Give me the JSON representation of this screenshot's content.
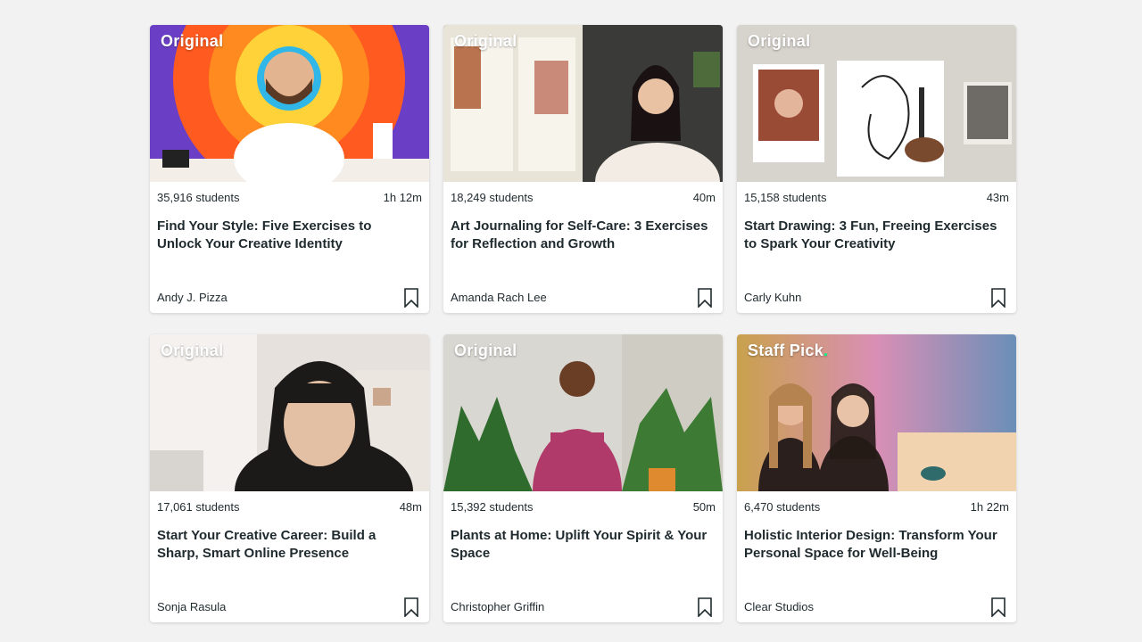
{
  "badge_dot": ".",
  "courses": [
    {
      "badge": "Original",
      "students": "35,916 students",
      "duration": "1h 12m",
      "title": "Find Your Style: Five Exercises to Unlock Your Creative Identity",
      "author": "Andy J. Pizza",
      "thumb_colors": [
        "#6a3fc6",
        "#ff5a1f",
        "#ffd23a",
        "#30b7e8"
      ]
    },
    {
      "badge": "Original",
      "students": "18,249 students",
      "duration": "40m",
      "title": "Art Journaling for Self-Care: 3 Exercises for Reflection and Growth",
      "author": "Amanda Rach Lee",
      "thumb_colors": [
        "#e9e4d8",
        "#2f3b33",
        "#c98a7a",
        "#4e6b3c"
      ]
    },
    {
      "badge": "Original",
      "students": "15,158 students",
      "duration": "43m",
      "title": "Start Drawing: 3 Fun, Freeing Exercises to Spark Your Creativity",
      "author": "Carly Kuhn",
      "thumb_colors": [
        "#efece7",
        "#d7d3cd",
        "#9a4b35",
        "#2a2a2a"
      ]
    },
    {
      "badge": "Original",
      "students": "17,061 students",
      "duration": "48m",
      "title": "Start Your Creative Career: Build a Sharp, Smart Online Presence",
      "author": "Sonja Rasula",
      "thumb_colors": [
        "#e6e1dc",
        "#f4f1ee",
        "#1c1a19",
        "#c9a68c"
      ]
    },
    {
      "badge": "Original",
      "students": "15,392 students",
      "duration": "50m",
      "title": "Plants at Home: Uplift Your Spirit & Your Space",
      "author": "Christopher Griffin",
      "thumb_colors": [
        "#d9d7d1",
        "#2f6b2c",
        "#b03a6a",
        "#e08a30"
      ]
    },
    {
      "badge": "Staff Pick",
      "students": "6,470 students",
      "duration": "1h 22m",
      "title": "Holistic Interior Design: Transform Your Personal Space for Well-Being",
      "author": "Clear Studios",
      "thumb_colors": [
        "#c9a14d",
        "#d98fb5",
        "#6a8fb8",
        "#f2d3b0"
      ]
    }
  ],
  "colors": {
    "accent": "#00ff84",
    "text": "#1f2a2e",
    "background": "#f2f2f2"
  }
}
